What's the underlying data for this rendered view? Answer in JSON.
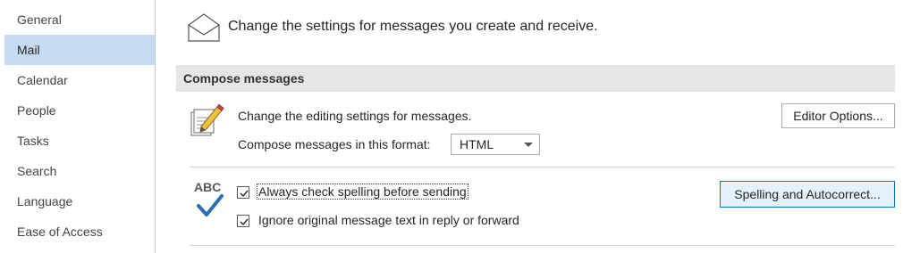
{
  "sidebar": {
    "items": [
      {
        "label": "General"
      },
      {
        "label": "Mail"
      },
      {
        "label": "Calendar"
      },
      {
        "label": "People"
      },
      {
        "label": "Tasks"
      },
      {
        "label": "Search"
      },
      {
        "label": "Language"
      },
      {
        "label": "Ease of Access"
      }
    ],
    "selected": "Mail"
  },
  "header": {
    "icon": "envelope-icon",
    "text": "Change the settings for messages you create and receive."
  },
  "compose": {
    "section_title": "Compose messages",
    "edit_icon": "pencil-paper-icon",
    "edit_text": "Change the editing settings for messages.",
    "editor_button": "Editor Options...",
    "format_label": "Compose messages in this format:",
    "format_value": "HTML"
  },
  "spelling": {
    "icon_text": "ABC",
    "always_check": {
      "label": "Always check spelling before sending",
      "checked": true
    },
    "ignore_original": {
      "label": "Ignore original message text in reply or forward",
      "checked": true
    },
    "spelling_button": "Spelling and Autocorrect..."
  },
  "colors": {
    "selected_nav": "#c5dcf0",
    "section_bar": "#e6e6e6",
    "focused_button_border": "#0078d7",
    "check_blue": "#2f6db5"
  }
}
